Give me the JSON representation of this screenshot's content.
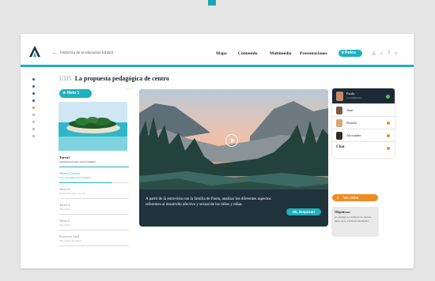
{
  "header": {
    "back_glyph": "←",
    "breadcrumb": "Didáctica de la educación Infantil",
    "nav": [
      "Mapa",
      "Contenido",
      "Multimedia",
      "Presentaciones"
    ],
    "retos_label": "Retos",
    "icons": [
      "user-icon",
      "bell-icon",
      "help-icon",
      "search-icon"
    ],
    "brand_color": "#1fb0bd"
  },
  "main": {
    "unit_number": "UD5",
    "title": "La propuesta pedagógica de centro",
    "reto_label": "Reto 1",
    "more": "···",
    "tasks": [
      {
        "title": "Tarea1",
        "subtitle": "Organización del cuerpo humano",
        "progress": 1.0
      },
      {
        "title": "Tarea 2 (vivir)",
        "subtitle": "Los contenidos de la unidad",
        "progress": 0.75
      },
      {
        "title": "Tarea 3",
        "subtitle": "Expresión oral y escrita",
        "progress": 0
      },
      {
        "title": "Tarea 4",
        "subtitle": "Psicología",
        "progress": 0
      },
      {
        "title": "Tarea 5",
        "subtitle": "Psicología",
        "progress": 0
      },
      {
        "title": "Proyecto final",
        "subtitle": "Psicología del grupo",
        "progress": 0
      }
    ]
  },
  "video": {
    "caption": "A partir de la entrevista con la familia de Paula, analizar los diferentes aspectos referentes al desarrollo afectivo y sexual de los niños y niñas.",
    "button": "Ok, Empezar!"
  },
  "people": [
    {
      "name": "Paula",
      "role": "Coordinadora"
    },
    {
      "name": "Juan",
      "role": ""
    },
    {
      "name": "Shasha",
      "role": ""
    },
    {
      "name": "Alexander",
      "role": ""
    }
  ],
  "chat_label": "Chat",
  "ver_retos": "Ver retos",
  "objectives": {
    "title": "Objetivos:",
    "body": "La entrega se realizará los jueves antes de la 13:00 del mediodía."
  }
}
